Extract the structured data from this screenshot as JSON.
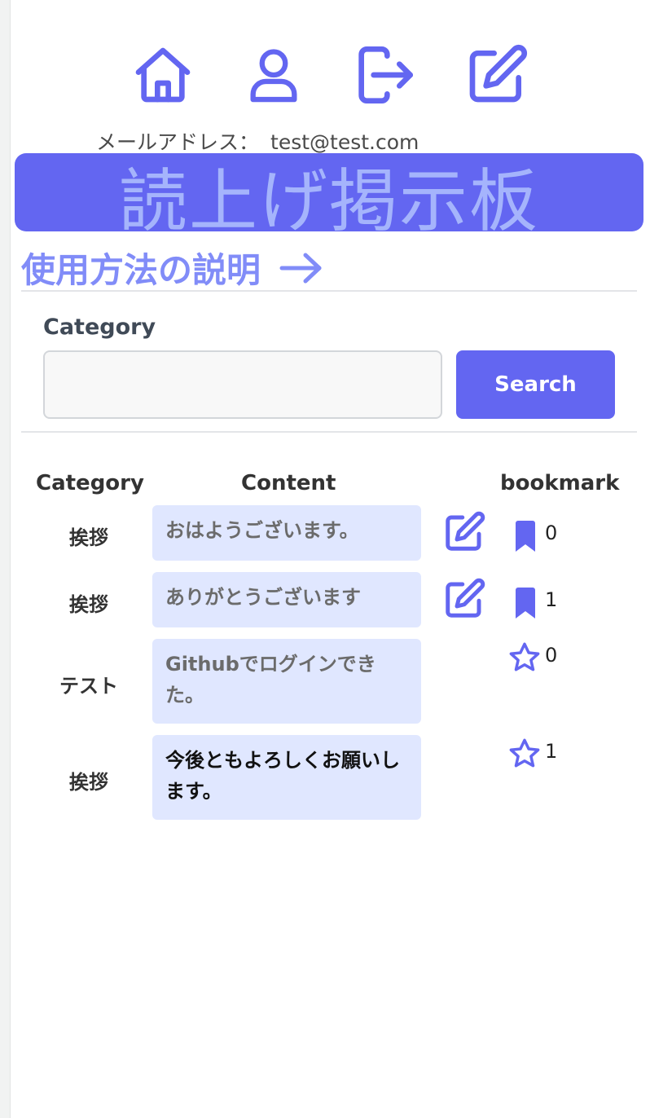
{
  "colors": {
    "accent": "#6366f1",
    "banner_text": "#a5b4fc",
    "howto": "#818cf8",
    "content_bg": "#e0e7ff"
  },
  "nav": {
    "icons": [
      "home-icon",
      "user-icon",
      "logout-icon",
      "edit-icon"
    ]
  },
  "user": {
    "email_label": "メールアドレス：",
    "email": "test@test.com"
  },
  "banner": {
    "title": "読上げ掲示板"
  },
  "howto": {
    "label": "使用方法の説明"
  },
  "search": {
    "label": "Category",
    "value": "",
    "placeholder": "",
    "button": "Search"
  },
  "table": {
    "headers": {
      "category": "Category",
      "content": "Content",
      "bookmark": "bookmark"
    },
    "rows": [
      {
        "category": "挨拶",
        "content": "おはようございます。",
        "editable": true,
        "bookmark_icon": "bookmark-icon",
        "count": "0"
      },
      {
        "category": "挨拶",
        "content": "ありがとうございます",
        "editable": true,
        "bookmark_icon": "bookmark-icon",
        "count": "1"
      },
      {
        "category": "テスト",
        "content": "Githubでログインできた。",
        "editable": false,
        "bookmark_icon": "star-icon",
        "count": "0"
      },
      {
        "category": "挨拶",
        "content": "今後ともよろしくお願いします。",
        "editable": false,
        "bookmark_icon": "star-icon",
        "count": "1"
      }
    ]
  }
}
